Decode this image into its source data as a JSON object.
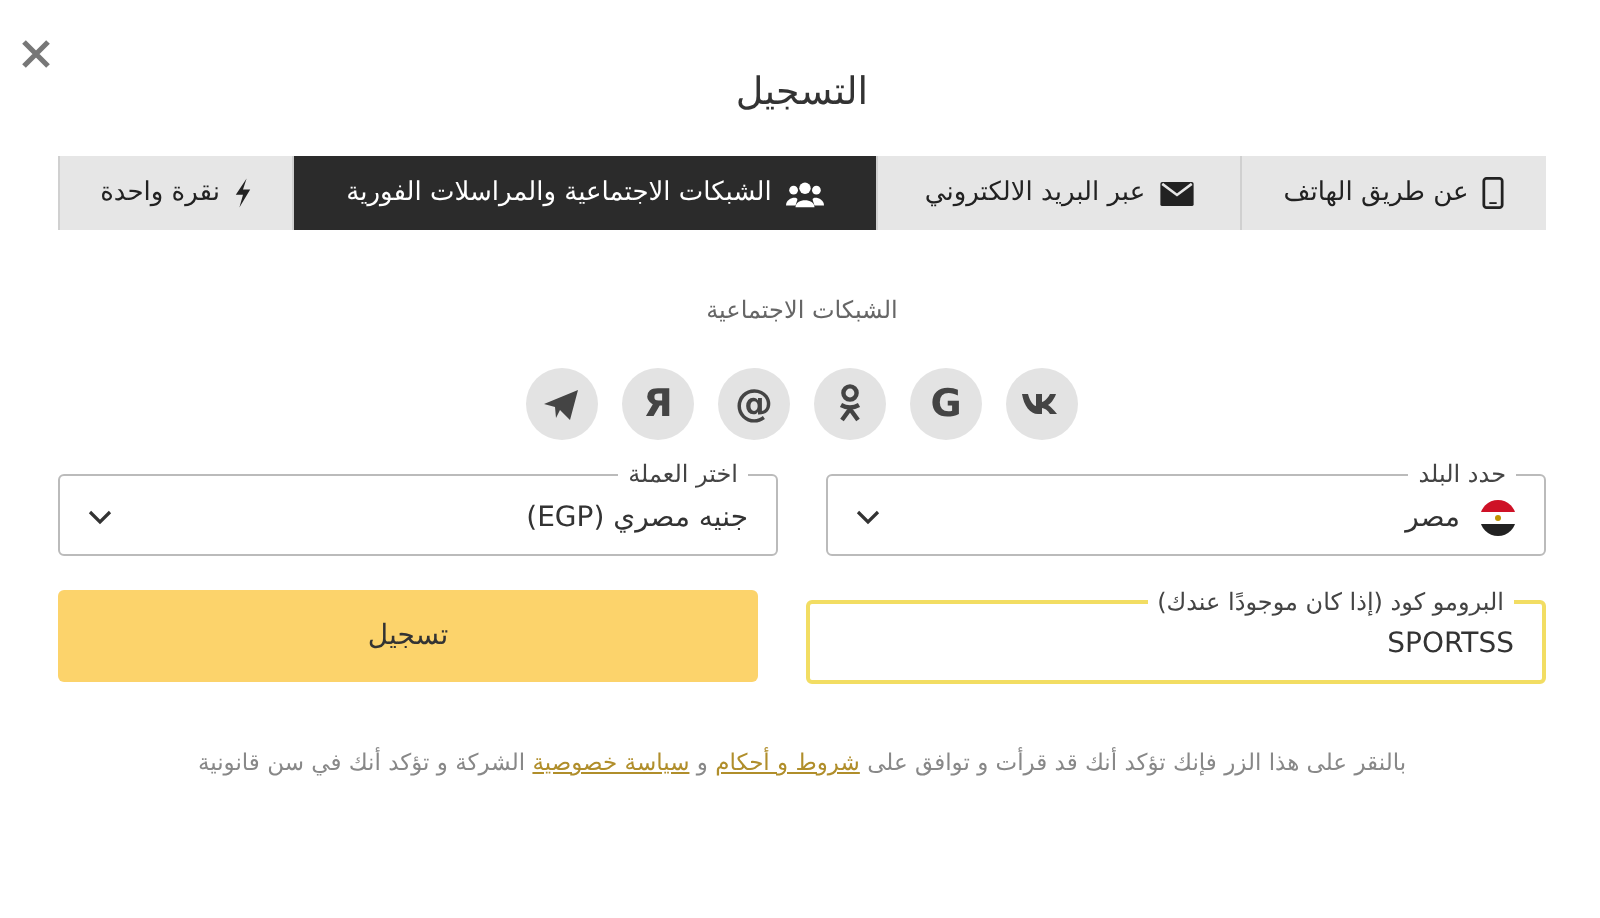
{
  "title": "التسجيل",
  "tabs": [
    {
      "label": "عن طريق الهاتف",
      "kind": "phone",
      "selected": false
    },
    {
      "label": "عبر البريد الالكتروني",
      "kind": "mail",
      "selected": false
    },
    {
      "label": "الشبكات الاجتماعية والمراسلات الفورية",
      "kind": "social",
      "selected": true
    },
    {
      "label": "نقرة واحدة",
      "kind": "oneclick",
      "selected": false
    }
  ],
  "social_label": "الشبكات الاجتماعية",
  "socials": [
    {
      "kind": "vk"
    },
    {
      "kind": "glyph",
      "text": "G"
    },
    {
      "kind": "ok"
    },
    {
      "kind": "glyph",
      "text": "@"
    },
    {
      "kind": "glyph",
      "text": "Я"
    },
    {
      "kind": "telegram"
    }
  ],
  "country": {
    "label": "حدد البلد",
    "value": "مصر"
  },
  "currency": {
    "label": "اختر العملة",
    "value": "جنيه مصري (EGP)"
  },
  "promo": {
    "label": "البرومو كود (إذا كان موجودًا عندك)",
    "value": "SPORTSS",
    "focused": true
  },
  "submit": "تسجيل",
  "terms": [
    {
      "kind": "text",
      "text": "بالنقر على هذا الزر فإنك تؤكد أنك قد قرأت و توافق على "
    },
    {
      "kind": "link",
      "text": "شروط و أحكام"
    },
    {
      "kind": "text",
      "text": " و "
    },
    {
      "kind": "link",
      "text": "سياسة خصوصية"
    },
    {
      "kind": "text",
      "text": " الشركة و تؤكد أنك في سن قانونية"
    }
  ]
}
